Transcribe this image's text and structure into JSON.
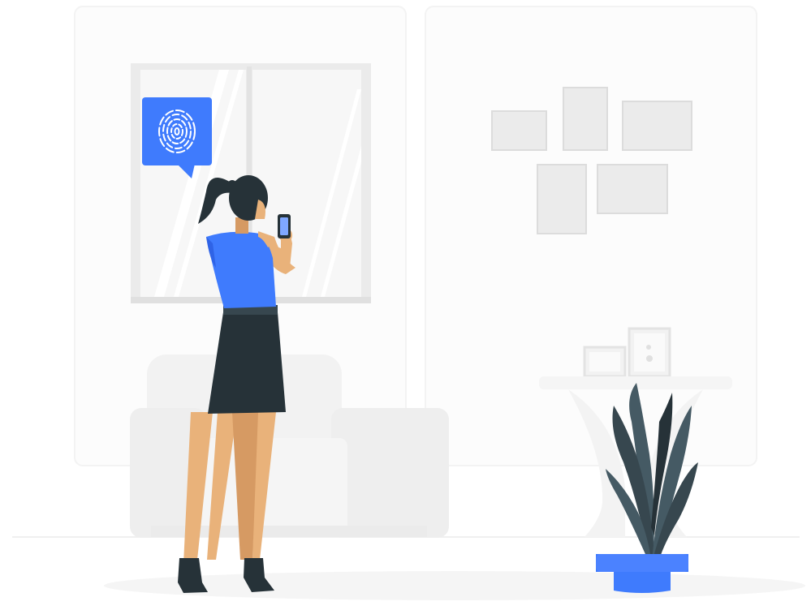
{
  "illustration": {
    "subject": "fingerprint-authentication-scene",
    "speech_bubble_icon": "fingerprint-icon",
    "colors": {
      "accent": "#3f7bfd",
      "accent_dark": "#2f63e6",
      "hair_skirt": "#263238",
      "skin": "#e9b27a",
      "skin_shade": "#d69a63",
      "background_panel": "#fafafa",
      "panel_border": "#f2f2f2",
      "window_frame": "#ebebeb",
      "window_glass": "#f5f5f5",
      "sofa": "#f0f0f0",
      "picture_frame": "#e6e6e6",
      "plant": "#455a64",
      "floor": "#f5f5f5"
    }
  }
}
